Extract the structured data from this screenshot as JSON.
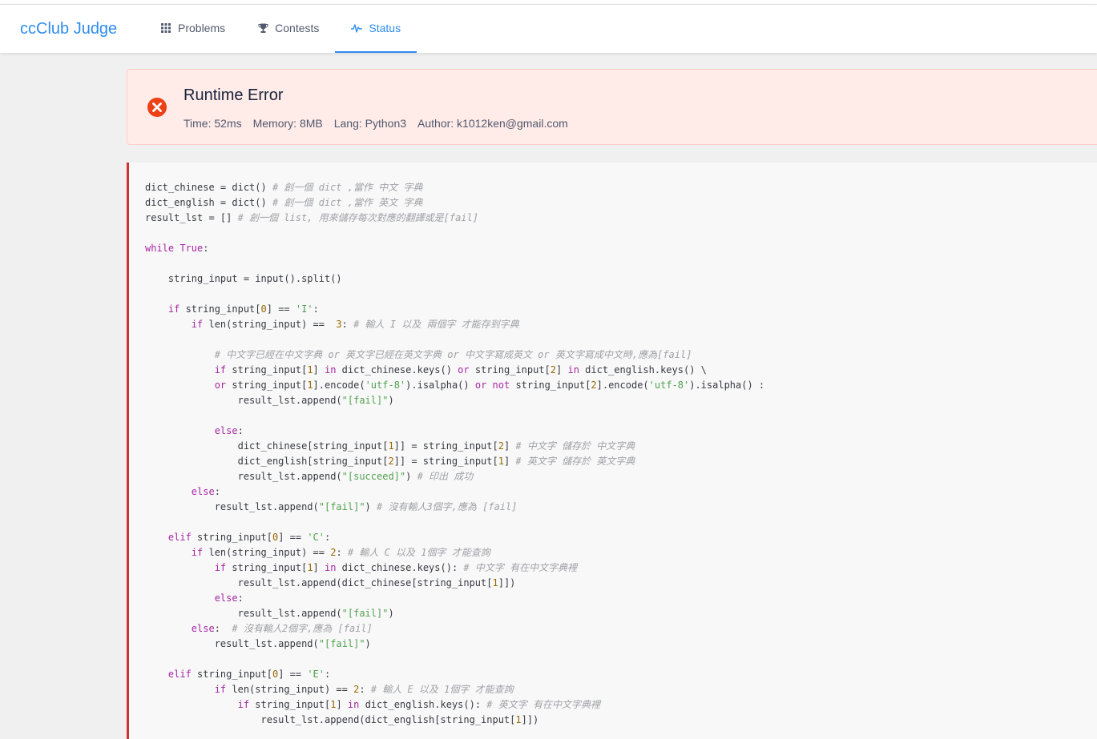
{
  "brand": "ccClub Judge",
  "nav": {
    "problems": "Problems",
    "contests": "Contests",
    "status": "Status"
  },
  "icons": {
    "problems": "grid-icon",
    "contests": "trophy-icon",
    "status": "pulse-icon",
    "status_result": "error-circle-icon"
  },
  "colors": {
    "accent": "#2d8cf0",
    "error": "#ed4014",
    "error_bg": "#ffebe8",
    "code_border": "#d32f2f"
  },
  "submission": {
    "result": "Runtime Error",
    "time": "Time: 52ms",
    "memory": "Memory: 8MB",
    "lang": "Lang: Python3",
    "author": "Author: k1012ken@gmail.com"
  },
  "code": [
    [
      [
        "",
        "dict_chinese = dict() "
      ],
      [
        "cm",
        "# 創一個 dict ,當作 中文 字典"
      ]
    ],
    [
      [
        "",
        "dict_english = dict() "
      ],
      [
        "cm",
        "# 創一個 dict ,當作 英文 字典"
      ]
    ],
    [
      [
        "",
        "result_lst = [] "
      ],
      [
        "cm",
        "# 創一個 list, 用來儲存每次對應的翻譯或是[fail]"
      ]
    ],
    [],
    [
      [
        "kw",
        "while"
      ],
      [
        "",
        " "
      ],
      [
        "kw",
        "True"
      ],
      [
        "",
        ":"
      ]
    ],
    [],
    [
      [
        "",
        "    string_input = input().split()"
      ]
    ],
    [],
    [
      [
        "",
        "    "
      ],
      [
        "kw",
        "if"
      ],
      [
        "",
        " string_input["
      ],
      [
        "num",
        "0"
      ],
      [
        "",
        "] == "
      ],
      [
        "str",
        "'I'"
      ],
      [
        "",
        ":"
      ]
    ],
    [
      [
        "",
        "        "
      ],
      [
        "kw",
        "if"
      ],
      [
        "",
        " len(string_input) ==  "
      ],
      [
        "num",
        "3"
      ],
      [
        "",
        ": "
      ],
      [
        "cm",
        "# 輸人 I 以及 兩個字 才能存到字典"
      ]
    ],
    [],
    [
      [
        "",
        "            "
      ],
      [
        "cm",
        "# 中文字已經在中文字典 or 英文字已經在英文字典 or 中文字寫成英文 or 英文字寫成中文時,應為[fail]"
      ]
    ],
    [
      [
        "",
        "            "
      ],
      [
        "kw",
        "if"
      ],
      [
        "",
        " string_input["
      ],
      [
        "num",
        "1"
      ],
      [
        "",
        "] "
      ],
      [
        "kw",
        "in"
      ],
      [
        "",
        " dict_chinese.keys() "
      ],
      [
        "kw",
        "or"
      ],
      [
        "",
        " string_input["
      ],
      [
        "num",
        "2"
      ],
      [
        "",
        "] "
      ],
      [
        "kw",
        "in"
      ],
      [
        "",
        " dict_english.keys() \\"
      ]
    ],
    [
      [
        "",
        "            "
      ],
      [
        "kw",
        "or"
      ],
      [
        "",
        " string_input["
      ],
      [
        "num",
        "1"
      ],
      [
        "",
        "].encode("
      ],
      [
        "str",
        "'utf-8'"
      ],
      [
        "",
        ").isalpha() "
      ],
      [
        "kw",
        "or"
      ],
      [
        "",
        " "
      ],
      [
        "kw",
        "not"
      ],
      [
        "",
        " string_input["
      ],
      [
        "num",
        "2"
      ],
      [
        "",
        "].encode("
      ],
      [
        "str",
        "'utf-8'"
      ],
      [
        "",
        ").isalpha() :"
      ]
    ],
    [
      [
        "",
        "                result_lst.append("
      ],
      [
        "str",
        "\"[fail]\""
      ],
      [
        "",
        ")"
      ]
    ],
    [],
    [
      [
        "",
        "            "
      ],
      [
        "kw",
        "else"
      ],
      [
        "",
        ":"
      ]
    ],
    [
      [
        "",
        "                dict_chinese[string_input["
      ],
      [
        "num",
        "1"
      ],
      [
        "",
        "]] = string_input["
      ],
      [
        "num",
        "2"
      ],
      [
        "",
        "] "
      ],
      [
        "cm",
        "# 中文字 儲存於 中文字典"
      ]
    ],
    [
      [
        "",
        "                dict_english[string_input["
      ],
      [
        "num",
        "2"
      ],
      [
        "",
        "]] = string_input["
      ],
      [
        "num",
        "1"
      ],
      [
        "",
        "] "
      ],
      [
        "cm",
        "# 英文字 儲存於 英文字典"
      ]
    ],
    [
      [
        "",
        "                result_lst.append("
      ],
      [
        "str",
        "\"[succeed]\""
      ],
      [
        "",
        ") "
      ],
      [
        "cm",
        "# 印出 成功"
      ]
    ],
    [
      [
        "",
        "        "
      ],
      [
        "kw",
        "else"
      ],
      [
        "",
        ":"
      ]
    ],
    [
      [
        "",
        "            result_lst.append("
      ],
      [
        "str",
        "\"[fail]\""
      ],
      [
        "",
        ") "
      ],
      [
        "cm",
        "# 沒有輸人3個字,應為 [fail]"
      ]
    ],
    [],
    [
      [
        "",
        "    "
      ],
      [
        "kw",
        "elif"
      ],
      [
        "",
        " string_input["
      ],
      [
        "num",
        "0"
      ],
      [
        "",
        "] == "
      ],
      [
        "str",
        "'C'"
      ],
      [
        "",
        ":"
      ]
    ],
    [
      [
        "",
        "        "
      ],
      [
        "kw",
        "if"
      ],
      [
        "",
        " len(string_input) == "
      ],
      [
        "num",
        "2"
      ],
      [
        "",
        ": "
      ],
      [
        "cm",
        "# 輸人 C 以及 1個字 才能查詢"
      ]
    ],
    [
      [
        "",
        "            "
      ],
      [
        "kw",
        "if"
      ],
      [
        "",
        " string_input["
      ],
      [
        "num",
        "1"
      ],
      [
        "",
        "] "
      ],
      [
        "kw",
        "in"
      ],
      [
        "",
        " dict_chinese.keys(): "
      ],
      [
        "cm",
        "# 中文字 有在中文字典裡"
      ]
    ],
    [
      [
        "",
        "                result_lst.append(dict_chinese[string_input["
      ],
      [
        "num",
        "1"
      ],
      [
        "",
        "]])"
      ]
    ],
    [
      [
        "",
        "            "
      ],
      [
        "kw",
        "else"
      ],
      [
        "",
        ":"
      ]
    ],
    [
      [
        "",
        "                result_lst.append("
      ],
      [
        "str",
        "\"[fail]\""
      ],
      [
        "",
        ")"
      ]
    ],
    [
      [
        "",
        "        "
      ],
      [
        "kw",
        "else"
      ],
      [
        "",
        ":  "
      ],
      [
        "cm",
        "# 沒有輸人2個字,應為 [fail]"
      ]
    ],
    [
      [
        "",
        "            result_lst.append("
      ],
      [
        "str",
        "\"[fail]\""
      ],
      [
        "",
        ")"
      ]
    ],
    [],
    [
      [
        "",
        "    "
      ],
      [
        "kw",
        "elif"
      ],
      [
        "",
        " string_input["
      ],
      [
        "num",
        "0"
      ],
      [
        "",
        "] == "
      ],
      [
        "str",
        "'E'"
      ],
      [
        "",
        ":"
      ]
    ],
    [
      [
        "",
        "            "
      ],
      [
        "kw",
        "if"
      ],
      [
        "",
        " len(string_input) == "
      ],
      [
        "num",
        "2"
      ],
      [
        "",
        ": "
      ],
      [
        "cm",
        "# 輸人 E 以及 1個字 才能查詢"
      ]
    ],
    [
      [
        "",
        "                "
      ],
      [
        "kw",
        "if"
      ],
      [
        "",
        " string_input["
      ],
      [
        "num",
        "1"
      ],
      [
        "",
        "] "
      ],
      [
        "kw",
        "in"
      ],
      [
        "",
        " dict_english.keys(): "
      ],
      [
        "cm",
        "# 英文字 有在中文字典裡"
      ]
    ],
    [
      [
        "",
        "                    result_lst.append(dict_english[string_input["
      ],
      [
        "num",
        "1"
      ],
      [
        "",
        "]])"
      ]
    ]
  ]
}
